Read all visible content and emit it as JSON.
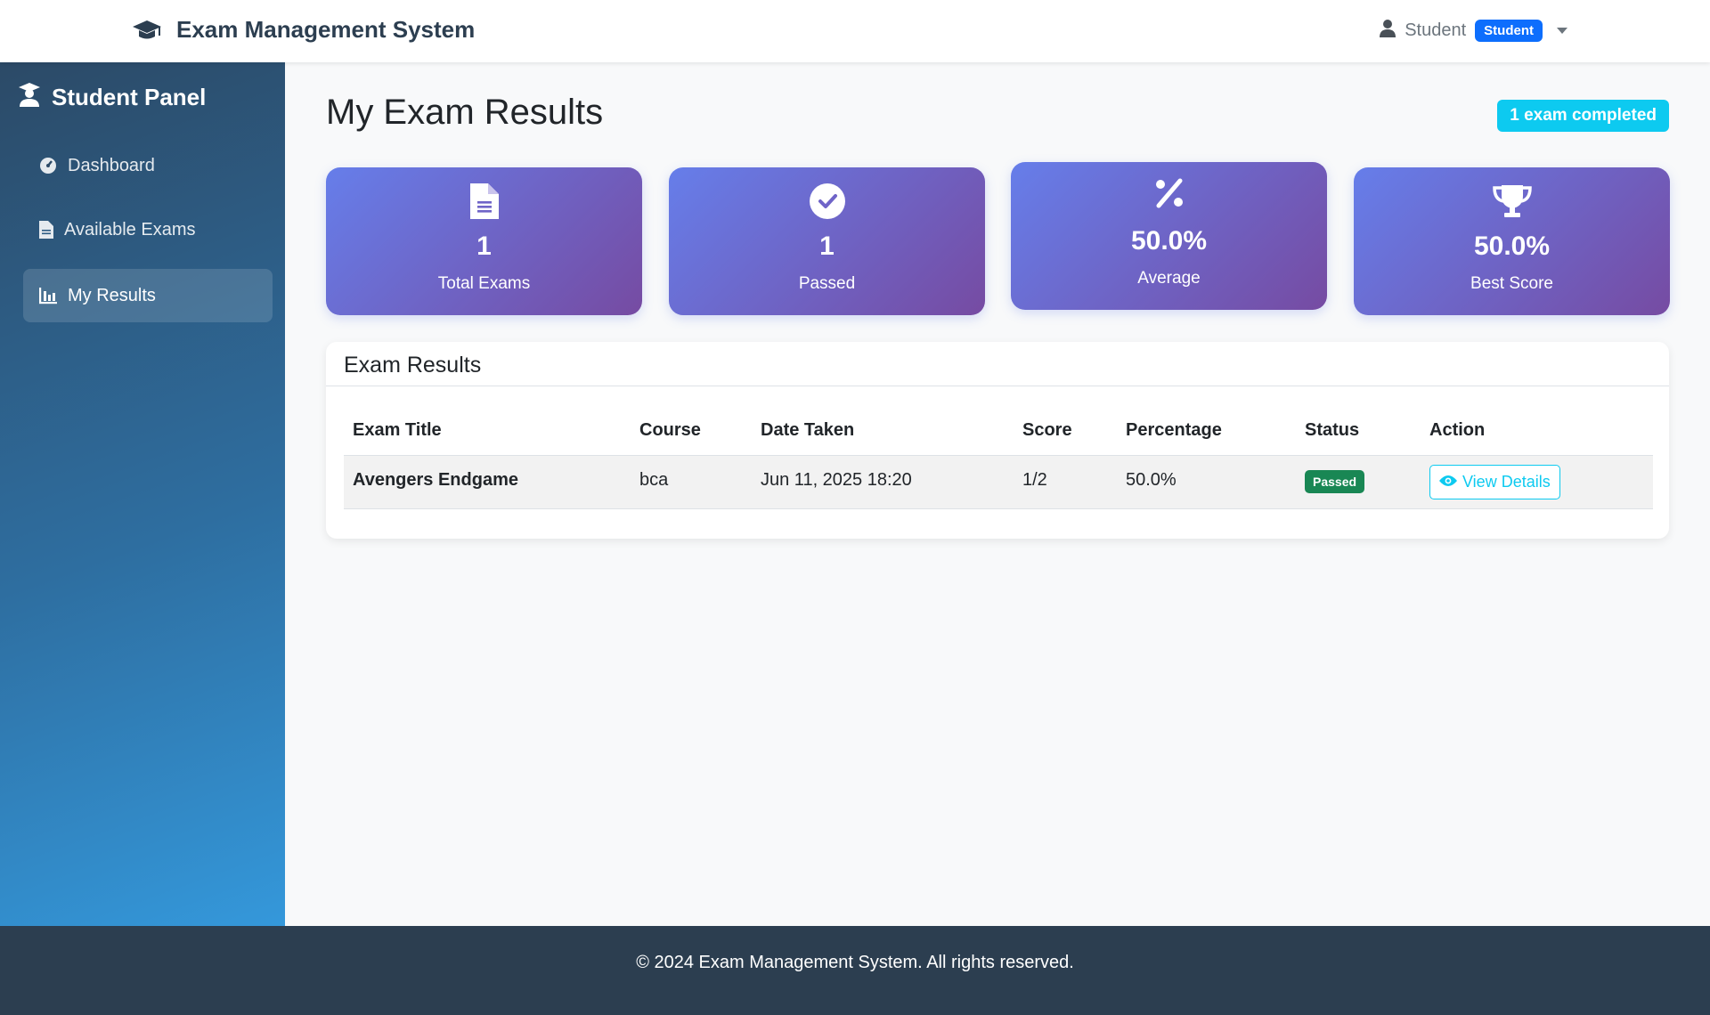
{
  "app": {
    "title": "Exam Management System"
  },
  "user": {
    "name": "Student",
    "role": "Student"
  },
  "sidebar": {
    "title": "Student Panel",
    "items": [
      {
        "label": "Dashboard",
        "icon": "tachometer-icon",
        "active": false
      },
      {
        "label": "Available Exams",
        "icon": "file-icon",
        "active": false
      },
      {
        "label": "My Results",
        "icon": "chart-icon",
        "active": true
      }
    ]
  },
  "page": {
    "title": "My Exam Results",
    "completed_badge": "1 exam completed"
  },
  "stats": [
    {
      "value": "1",
      "label": "Total Exams",
      "icon": "file-text-icon"
    },
    {
      "value": "1",
      "label": "Passed",
      "icon": "check-circle-icon"
    },
    {
      "value": "50.0%",
      "label": "Average",
      "icon": "percent-icon"
    },
    {
      "value": "50.0%",
      "label": "Best Score",
      "icon": "trophy-icon"
    }
  ],
  "results": {
    "title": "Exam Results",
    "columns": [
      "Exam Title",
      "Course",
      "Date Taken",
      "Score",
      "Percentage",
      "Status",
      "Action"
    ],
    "rows": [
      {
        "exam_title": "Avengers Endgame",
        "course": "bca",
        "date_taken": "Jun 11, 2025 18:20",
        "score": "1/2",
        "percentage": "50.0%",
        "status": "Passed",
        "action": "View Details"
      }
    ]
  },
  "footer": {
    "text": "© 2024 Exam Management System. All rights reserved."
  },
  "colors": {
    "accent": "#0d6efd",
    "info": "#0dcaf0",
    "success": "#198754",
    "card_gradient_start": "#667eea",
    "card_gradient_end": "#764ba2",
    "footer_bg": "#2c3e50"
  }
}
